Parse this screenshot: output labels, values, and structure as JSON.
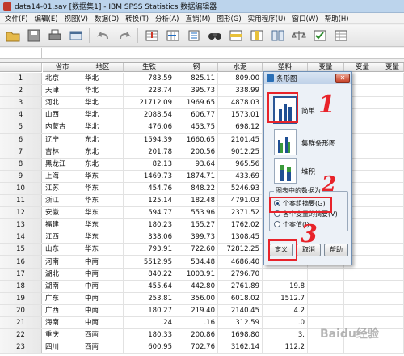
{
  "window": {
    "title": "data14-01.sav [数据集1] - IBM SPSS Statistics 数据编辑器"
  },
  "menu": [
    "文件(F)",
    "编辑(E)",
    "视图(V)",
    "数据(D)",
    "转换(T)",
    "分析(A)",
    "直销(M)",
    "图形(G)",
    "实用程序(U)",
    "窗口(W)",
    "帮助(H)"
  ],
  "toolbar": {
    "icons": [
      "open-folder-icon",
      "save-icon",
      "print-icon",
      "dialog-recall-icon",
      "undo-icon",
      "redo-icon",
      "goto-case-icon",
      "goto-variable-icon",
      "variables-icon",
      "find-icon",
      "insert-cases-icon",
      "insert-variable-icon",
      "split-file-icon",
      "weight-cases-icon",
      "select-cases-icon",
      "value-labels-icon"
    ]
  },
  "grid": {
    "columns": [
      "省市",
      "地区",
      "生铁",
      "钢",
      "水泥",
      "塑料",
      "变量",
      "变量",
      "变量"
    ],
    "rows": [
      {
        "n": "1",
        "cells": [
          "北京",
          "华北",
          "783.59",
          "825.11",
          "809.00",
          ""
        ]
      },
      {
        "n": "2",
        "cells": [
          "天津",
          "华北",
          "228.74",
          "395.73",
          "338.99",
          ""
        ]
      },
      {
        "n": "3",
        "cells": [
          "河北",
          "华北",
          "21712.09",
          "1969.65",
          "4878.03",
          ""
        ]
      },
      {
        "n": "4",
        "cells": [
          "山西",
          "华北",
          "2088.54",
          "606.77",
          "1573.01",
          ""
        ]
      },
      {
        "n": "5",
        "cells": [
          "内蒙古",
          "华北",
          "476.06",
          "453.75",
          "698.12",
          ""
        ]
      },
      {
        "n": "6",
        "cells": [
          "辽宁",
          "东北",
          "1594.39",
          "1660.65",
          "2101.45",
          ""
        ]
      },
      {
        "n": "7",
        "cells": [
          "吉林",
          "东北",
          "201.78",
          "200.56",
          "9012.25",
          ""
        ]
      },
      {
        "n": "8",
        "cells": [
          "黑龙江",
          "东北",
          "82.13",
          "93.64",
          "965.56",
          ""
        ]
      },
      {
        "n": "9",
        "cells": [
          "上海",
          "华东",
          "1469.73",
          "1874.71",
          "433.69",
          ""
        ]
      },
      {
        "n": "10",
        "cells": [
          "江苏",
          "华东",
          "454.76",
          "848.22",
          "5246.93",
          ""
        ]
      },
      {
        "n": "11",
        "cells": [
          "浙江",
          "华东",
          "125.14",
          "182.48",
          "4791.03",
          ""
        ]
      },
      {
        "n": "12",
        "cells": [
          "安徽",
          "华东",
          "594.77",
          "553.96",
          "2371.52",
          ""
        ]
      },
      {
        "n": "13",
        "cells": [
          "福建",
          "华东",
          "180.23",
          "155.27",
          "1762.02",
          ""
        ]
      },
      {
        "n": "14",
        "cells": [
          "江西",
          "华东",
          "338.06",
          "399.73",
          "1308.45",
          ""
        ]
      },
      {
        "n": "15",
        "cells": [
          "山东",
          "华东",
          "793.91",
          "722.60",
          "72812.25",
          ""
        ]
      },
      {
        "n": "16",
        "cells": [
          "河南",
          "中南",
          "5512.95",
          "534.48",
          "4686.40",
          ""
        ]
      },
      {
        "n": "17",
        "cells": [
          "湖北",
          "中南",
          "840.22",
          "1003.91",
          "2796.70",
          ""
        ]
      },
      {
        "n": "18",
        "cells": [
          "湖南",
          "中南",
          "455.64",
          "442.80",
          "2761.89",
          "19.8"
        ]
      },
      {
        "n": "19",
        "cells": [
          "广东",
          "中南",
          "253.81",
          "356.00",
          "6018.02",
          "1512.7"
        ]
      },
      {
        "n": "20",
        "cells": [
          "广西",
          "中南",
          "180.27",
          "219.40",
          "2140.45",
          "4.2"
        ]
      },
      {
        "n": "21",
        "cells": [
          "海南",
          "中南",
          ".24",
          ".16",
          "312.59",
          ".0"
        ]
      },
      {
        "n": "22",
        "cells": [
          "重庆",
          "西南",
          "180.33",
          "200.86",
          "1698.80",
          "3."
        ]
      },
      {
        "n": "23",
        "cells": [
          "四川",
          "西南",
          "600.95",
          "702.76",
          "3162.14",
          "112.2"
        ]
      }
    ]
  },
  "dialog": {
    "title": "条形图",
    "close": "✕",
    "options": [
      {
        "label": "简单",
        "selected": true
      },
      {
        "label": "集群条形图",
        "selected": false
      },
      {
        "label": "堆积",
        "selected": false
      }
    ],
    "group_label": "图表中的数据为",
    "radios": [
      {
        "label": "个案组摘要(G)",
        "checked": true
      },
      {
        "label": "各个变量的摘要(V)",
        "checked": false
      },
      {
        "label": "个案值(I)",
        "checked": false
      }
    ],
    "buttons": {
      "define": "定义",
      "cancel": "取消",
      "help": "帮助"
    }
  },
  "annotations": {
    "colors": {
      "annotation": "#e8232a"
    },
    "numbers": [
      "1",
      "2",
      "3"
    ]
  },
  "watermark": "Baidu经验"
}
